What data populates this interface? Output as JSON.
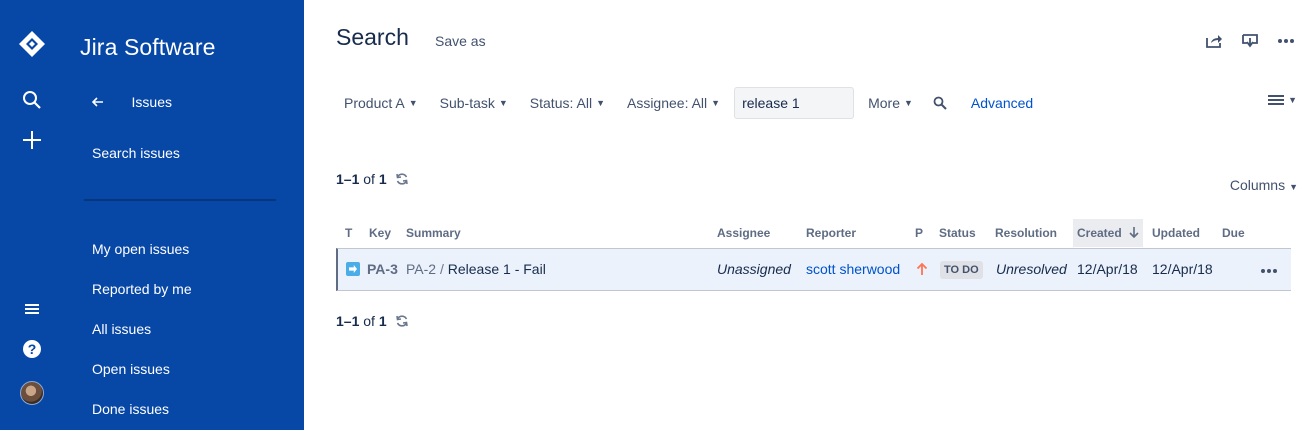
{
  "app": {
    "name": "Jira Software"
  },
  "sidebar": {
    "back_label": "Issues",
    "search_label": "Search issues",
    "filters": [
      "My open issues",
      "Reported by me",
      "All issues",
      "Open issues",
      "Done issues"
    ]
  },
  "header": {
    "title": "Search",
    "save_as": "Save as"
  },
  "filters": {
    "project": "Product A",
    "type": "Sub-task",
    "status": "Status: All",
    "assignee": "Assignee: All",
    "text_value": "release 1",
    "more": "More",
    "advanced": "Advanced"
  },
  "pagination": {
    "range": "1–1",
    "of": "of",
    "total": "1"
  },
  "columns_label": "Columns",
  "table": {
    "headers": {
      "t": "T",
      "key": "Key",
      "summary": "Summary",
      "assignee": "Assignee",
      "reporter": "Reporter",
      "p": "P",
      "status": "Status",
      "resolution": "Resolution",
      "created": "Created",
      "updated": "Updated",
      "due": "Due"
    },
    "rows": [
      {
        "key": "PA-3",
        "parent": "PA-2",
        "separator": "/",
        "summary": "Release 1 - Fail",
        "assignee": "Unassigned",
        "reporter": "scott sherwood",
        "priority_icon": "arrow-up-icon",
        "status": "TO DO",
        "resolution": "Unresolved",
        "created": "12/Apr/18",
        "updated": "12/Apr/18",
        "due": ""
      }
    ]
  },
  "colors": {
    "nav": "#0747a6",
    "link": "#0052cc",
    "row_highlight": "#ebf2fb",
    "priority": "#ff7452"
  }
}
